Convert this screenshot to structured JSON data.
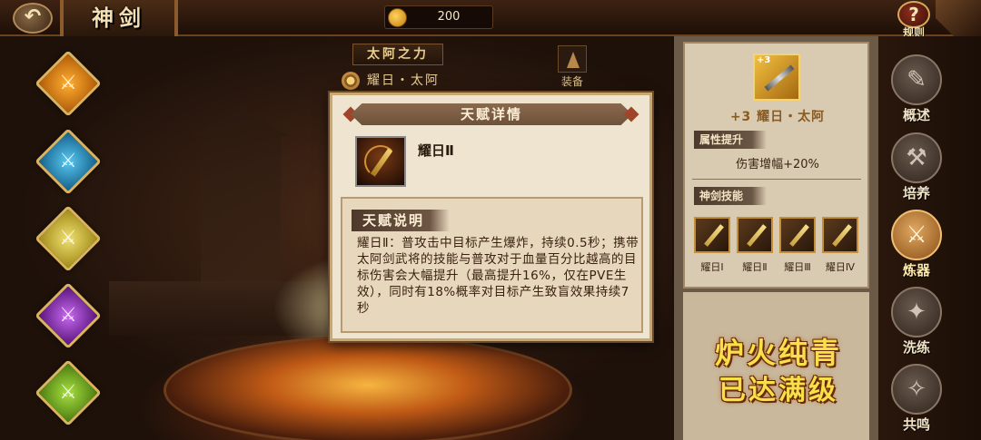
{
  "header": {
    "back_icon": "back-arrow-icon",
    "title": "神剑",
    "currency": {
      "icon": "coin-icon",
      "amount": "200"
    },
    "rules": {
      "icon": "question-icon",
      "label": "规则"
    }
  },
  "left_menu": [
    {
      "icon": "fire-sword-icon",
      "color": "#f0a020"
    },
    {
      "icon": "ice-sword-icon",
      "color": "#3aa8d8"
    },
    {
      "icon": "light-sword-icon",
      "color": "#e0d050"
    },
    {
      "icon": "thunder-sword-icon",
      "color": "#a040d0"
    },
    {
      "icon": "wind-sword-icon",
      "color": "#80c030"
    }
  ],
  "center_top": {
    "power_title": "太阿之力",
    "sword_name": "耀日・太阿",
    "equip_label": "装备"
  },
  "info_panel": {
    "sword_level": "+3",
    "sword_title": "+3 耀日・太阿",
    "attr_section": "属性提升",
    "attr_value": "伤害增幅+20%",
    "skill_section": "神剑技能",
    "skills": [
      {
        "label": "耀日Ⅰ"
      },
      {
        "label": "耀日Ⅱ"
      },
      {
        "label": "耀日Ⅲ"
      },
      {
        "label": "耀日Ⅳ"
      }
    ],
    "max_line1": "炉火纯青",
    "max_line2": "已达满级"
  },
  "right_nav": [
    {
      "label": "概述",
      "icon": "overview-icon",
      "active": false
    },
    {
      "label": "培养",
      "icon": "hammer-icon",
      "active": false
    },
    {
      "label": "炼器",
      "icon": "forge-icon",
      "active": true
    },
    {
      "label": "洗练",
      "icon": "refine-icon",
      "active": false
    },
    {
      "label": "共鸣",
      "icon": "resonance-icon",
      "active": false
    }
  ],
  "dialog": {
    "title": "天赋详情",
    "talent_name": "耀日Ⅱ",
    "desc_title": "天赋说明",
    "desc_text": "耀日Ⅱ：普攻击中目标产生爆炸，持续0.5秒；携带太阿剑武将的技能与普攻对于血量百分比越高的目标伤害会大幅提升（最高提升16%，仅在PVE生效），同时有18%概率对目标产生致盲效果持续7秒"
  }
}
